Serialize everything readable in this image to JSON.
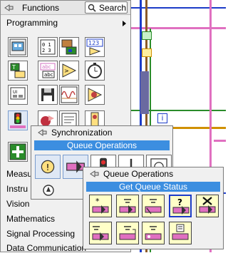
{
  "palette": {
    "title": "Functions",
    "search_label": "Search",
    "categories": [
      {
        "label": "Programming"
      },
      {
        "label": "Measu"
      },
      {
        "label": "Instru"
      },
      {
        "label": "Vision"
      },
      {
        "label": "Mathematics"
      },
      {
        "label": "Signal Processing"
      },
      {
        "label": "Data Communication"
      }
    ]
  },
  "sync_palette": {
    "title": "Synchronization",
    "subtitle": "Queue Operations"
  },
  "queue_palette": {
    "title": "Queue Operations",
    "subtitle": "Get Queue Status"
  },
  "diagram": {
    "colors": {
      "wire_pink": "#e070c0",
      "wire_blue": "#1c3cc8",
      "wire_green": "#2a8c2a",
      "wire_orange": "#d09000",
      "wire_brown": "#8c5a28",
      "queue_bg": "#ffffc8",
      "selection": "#3c8ee0"
    },
    "indicator_text": "i"
  }
}
